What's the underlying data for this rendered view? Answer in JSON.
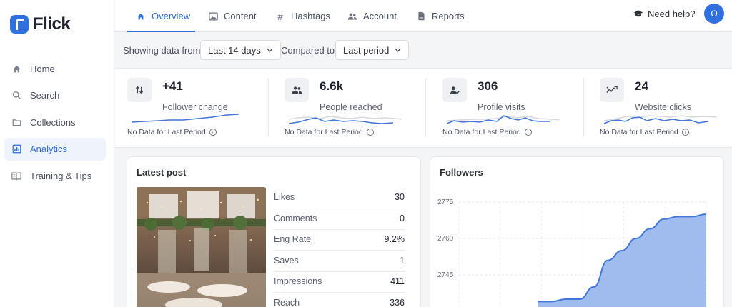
{
  "app": {
    "name": "Flick"
  },
  "sidebar": {
    "items": [
      {
        "label": "Home",
        "icon": "home-icon"
      },
      {
        "label": "Search",
        "icon": "search-icon"
      },
      {
        "label": "Collections",
        "icon": "folder-icon"
      },
      {
        "label": "Analytics",
        "icon": "analytics-icon",
        "active": true
      },
      {
        "label": "Training & Tips",
        "icon": "book-icon"
      }
    ]
  },
  "tabs": [
    {
      "label": "Overview",
      "icon": "home-icon",
      "active": true
    },
    {
      "label": "Content",
      "icon": "image-icon"
    },
    {
      "label": "Hashtags",
      "icon": "hashtag-icon"
    },
    {
      "label": "Account",
      "icon": "users-icon"
    },
    {
      "label": "Reports",
      "icon": "document-icon"
    }
  ],
  "header": {
    "help_label": "Need help?",
    "avatar_initial": "O"
  },
  "filters": {
    "showing_label": "Showing data from",
    "range_value": "Last 14 days",
    "compared_label": "Compared to",
    "compare_value": "Last period"
  },
  "stats": [
    {
      "value": "+41",
      "label": "Follower change",
      "note": "No Data for Last Period",
      "icon": "arrows-updown-icon"
    },
    {
      "value": "6.6k",
      "label": "People reached",
      "note": "No Data for Last Period",
      "icon": "people-icon"
    },
    {
      "value": "306",
      "label": "Profile visits",
      "note": "No Data for Last Period",
      "icon": "person-check-icon"
    },
    {
      "value": "24",
      "label": "Website clicks",
      "note": "No Data for Last Period",
      "icon": "trend-icon"
    }
  ],
  "latest_post": {
    "title": "Latest post",
    "metrics": [
      {
        "label": "Likes",
        "value": "30"
      },
      {
        "label": "Comments",
        "value": "0"
      },
      {
        "label": "Eng Rate",
        "value": "9.2%"
      },
      {
        "label": "Saves",
        "value": "1"
      },
      {
        "label": "Impressions",
        "value": "411"
      },
      {
        "label": "Reach",
        "value": "336"
      }
    ]
  },
  "followers": {
    "title": "Followers"
  },
  "chart_data": {
    "type": "area",
    "title": "Followers",
    "yticks": [
      "2775",
      "2760",
      "2745"
    ],
    "ylim": [
      2735,
      2780
    ],
    "series": [
      {
        "values": [
          2734,
          2734,
          2735,
          2735,
          2740,
          2751,
          2755,
          2760,
          2764,
          2768,
          2769,
          2769,
          2770
        ]
      }
    ],
    "colors": {
      "line": "#3f76d8",
      "fill": "#8fb0ec"
    }
  },
  "colors": {
    "accent": "#2f6fde"
  }
}
